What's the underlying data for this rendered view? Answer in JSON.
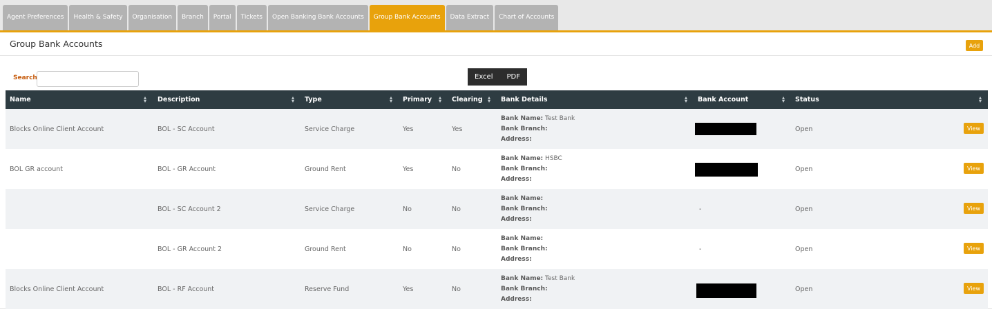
{
  "tabs": [
    {
      "label": "Agent Preferences"
    },
    {
      "label": "Health & Safety"
    },
    {
      "label": "Organisation"
    },
    {
      "label": "Branch"
    },
    {
      "label": "Portal"
    },
    {
      "label": "Tickets"
    },
    {
      "label": "Open Banking Bank Accounts"
    },
    {
      "label": "Group Bank Accounts"
    },
    {
      "label": "Data Extract"
    },
    {
      "label": "Chart of Accounts"
    }
  ],
  "active_tab": "Group Bank Accounts",
  "panel": {
    "title": "Group Bank Accounts",
    "add_label": "Add"
  },
  "search": {
    "label": "Search",
    "value": "",
    "placeholder": ""
  },
  "export": {
    "excel_label": "Excel",
    "pdf_label": "PDF"
  },
  "table": {
    "columns": {
      "name": "Name",
      "description": "Description",
      "type": "Type",
      "primary": "Primary",
      "clearing": "Clearing",
      "bank_details": "Bank Details",
      "bank_account": "Bank Account",
      "status": "Status"
    },
    "bank_labels": {
      "name": "Bank Name",
      "branch": "Bank Branch",
      "address": "Address"
    },
    "view_label": "View",
    "rows": [
      {
        "name": "Blocks Online Client Account",
        "description": "BOL - SC Account",
        "type": "Service Charge",
        "primary": "Yes",
        "clearing": "Yes",
        "bank_name": "Test Bank",
        "bank_branch": "",
        "address": "",
        "bank_account": "",
        "status": "Open"
      },
      {
        "name": "BOL GR account",
        "description": "BOL - GR Account",
        "type": "Ground Rent",
        "primary": "Yes",
        "clearing": "No",
        "bank_name": "HSBC",
        "bank_branch": "",
        "address": "",
        "bank_account": "",
        "status": "Open"
      },
      {
        "name": "",
        "description": "BOL - SC Account 2",
        "type": "Service Charge",
        "primary": "No",
        "clearing": "No",
        "bank_name": "",
        "bank_branch": "",
        "address": "",
        "bank_account": "-",
        "status": "Open"
      },
      {
        "name": "",
        "description": "BOL - GR Account 2",
        "type": "Ground Rent",
        "primary": "No",
        "clearing": "No",
        "bank_name": "",
        "bank_branch": "",
        "address": "",
        "bank_account": "-",
        "status": "Open"
      },
      {
        "name": "Blocks Online Client Account",
        "description": "BOL - RF Account",
        "type": "Reserve Fund",
        "primary": "Yes",
        "clearing": "No",
        "bank_name": "Test Bank",
        "bank_branch": "",
        "address": "",
        "bank_account": "",
        "status": "Open"
      }
    ]
  },
  "colors": {
    "accent": "#e8a20c",
    "header_bg": "#2e3c42",
    "search_label": "#c65b0c",
    "tab_inactive": "#b3b3b3"
  },
  "icons": {
    "sort": "sort-icon"
  }
}
